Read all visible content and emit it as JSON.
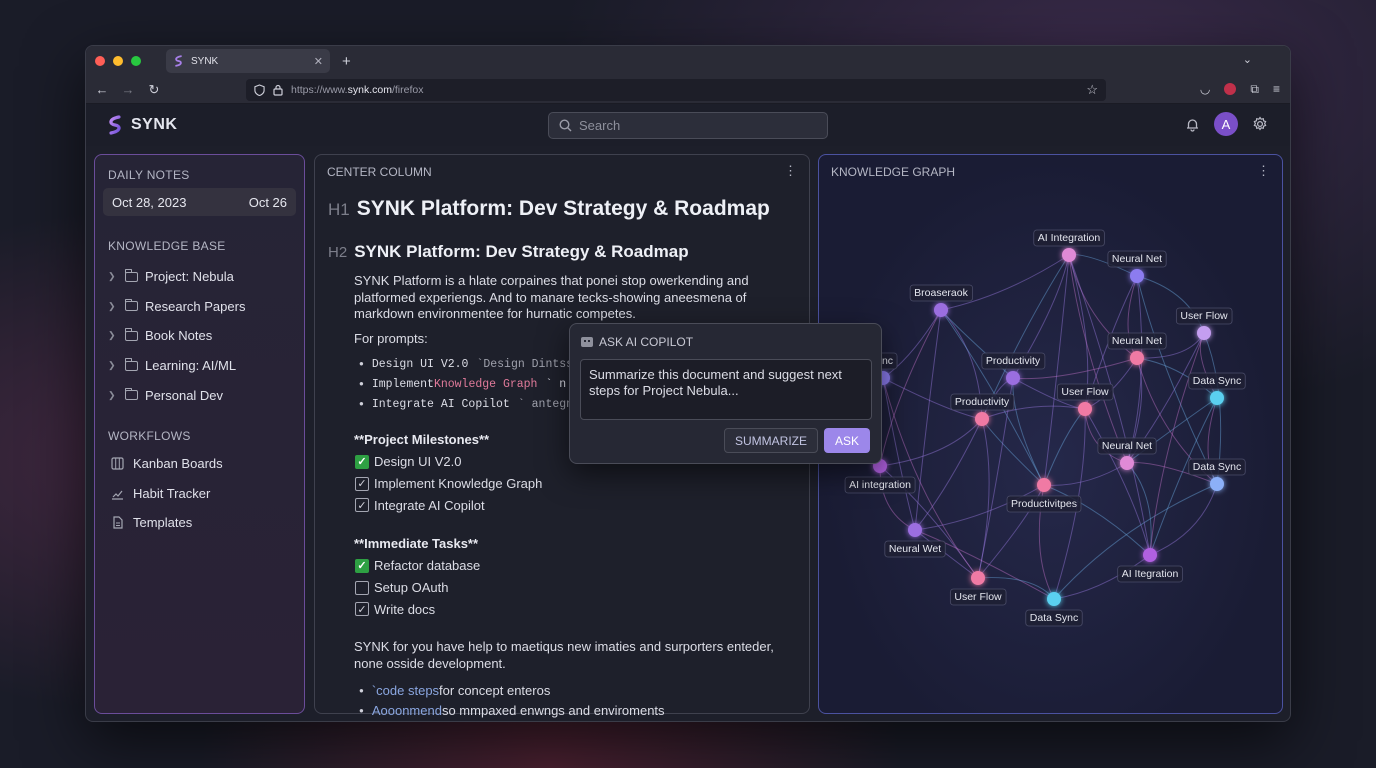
{
  "browser": {
    "tab_title": "SYNK",
    "url_prefix": "https://www.",
    "url_host": "synk.com",
    "url_path": "/firefox"
  },
  "app": {
    "brand": "SYNK",
    "search_placeholder": "Search",
    "avatar_letter": "A"
  },
  "left": {
    "daily_title": "DAILY NOTES",
    "date_full": "Oct 28, 2023",
    "date_short": "Oct 26",
    "kb_title": "KNOWLEDGE BASE",
    "kb_items": [
      "Project: Nebula",
      "Research Papers",
      "Book Notes",
      "Learning: AI/ML",
      "Personal Dev"
    ],
    "wf_title": "WORKFLOWS",
    "wf_items": [
      "Kanban Boards",
      "Habit Tracker",
      "Templates"
    ]
  },
  "center": {
    "title": "CENTER COLUMN",
    "h1_tag": "H1",
    "h1": "SYNK Platform: Dev Strategy & Roadmap",
    "h2_tag": "H2",
    "h2": "SYNK Platform: Dev Strategy & Roadmap",
    "para1": "SYNK Platform is a hlate corpaines that ponei stop owerkending and platformed experiengs. And to manare tecks-showing aneesmena of markdown environmentee for hurnatic competes.",
    "prompts_label": "For prompts:",
    "code_items": [
      {
        "a": "Design UI V2.0 ",
        "b": "`Design Dintss",
        "c": ""
      },
      {
        "a": "Implement ",
        "b": "Knowledge Graph",
        "c": "` n"
      },
      {
        "a": "Integrate AI Copilot",
        "b": "` antegntm",
        "c": ""
      }
    ],
    "milestones_head": "**Project Milestones**",
    "milestones": [
      {
        "label": "Design UI V2.0",
        "state": "done"
      },
      {
        "label": "Implement Knowledge Graph",
        "state": "checked"
      },
      {
        "label": "Integrate AI Copilot",
        "state": "checked"
      }
    ],
    "tasks_head": "**Immediate Tasks**",
    "tasks": [
      {
        "label": "Refactor database",
        "state": "done"
      },
      {
        "label": "Setup OAuth",
        "state": "empty"
      },
      {
        "label": "Write docs",
        "state": "checked"
      }
    ],
    "para3": "SYNK for you have help to maetiqus new imaties and surporters enteder, none osside development.",
    "bottom_items": [
      {
        "a": "`code steps",
        "b": " for concept enteros"
      },
      {
        "a": "Aooonmend",
        "b": " so mmpaxed enwngs and enviroments"
      }
    ]
  },
  "copilot": {
    "title": "ASK AI COPILOT",
    "text": "Summarize this document and suggest next steps for Project Nebula...",
    "summarize_label": "SUMMARIZE",
    "ask_label": "ASK"
  },
  "graph": {
    "title": "KNOWLEDGE GRAPH",
    "nodes": [
      {
        "label": "AI Integration",
        "color": "#e08ad6"
      },
      {
        "label": "Neural Net",
        "color": "#8c7cf0"
      },
      {
        "label": "Broaseraok",
        "color": "#9b6ee0"
      },
      {
        "label": "User Flow",
        "color": "#c49ef0"
      },
      {
        "label": "Productivity",
        "color": "#9b6ee0"
      },
      {
        "label": "Neural Net",
        "color": "#f07aa4"
      },
      {
        "label": "a Sync",
        "color": "#8c7cf0"
      },
      {
        "label": "Data Sync",
        "color": "#5ad0f0"
      },
      {
        "label": "Productivity",
        "color": "#f07aa4"
      },
      {
        "label": "User Flow",
        "color": "#f07aa4"
      },
      {
        "label": "Neural Net",
        "color": "#e08ad6"
      },
      {
        "label": "AI integration",
        "color": "#b060e0"
      },
      {
        "label": "Data Sync",
        "color": "#8cb0f8"
      },
      {
        "label": "Productivitpes",
        "color": "#f07aa4"
      },
      {
        "label": "Neural Wet",
        "color": "#9b6ee0"
      },
      {
        "label": "AI Itegration",
        "color": "#b060e0"
      },
      {
        "label": "User Flow",
        "color": "#f07aa4"
      },
      {
        "label": "Data Sync",
        "color": "#5ad0f0"
      }
    ]
  }
}
